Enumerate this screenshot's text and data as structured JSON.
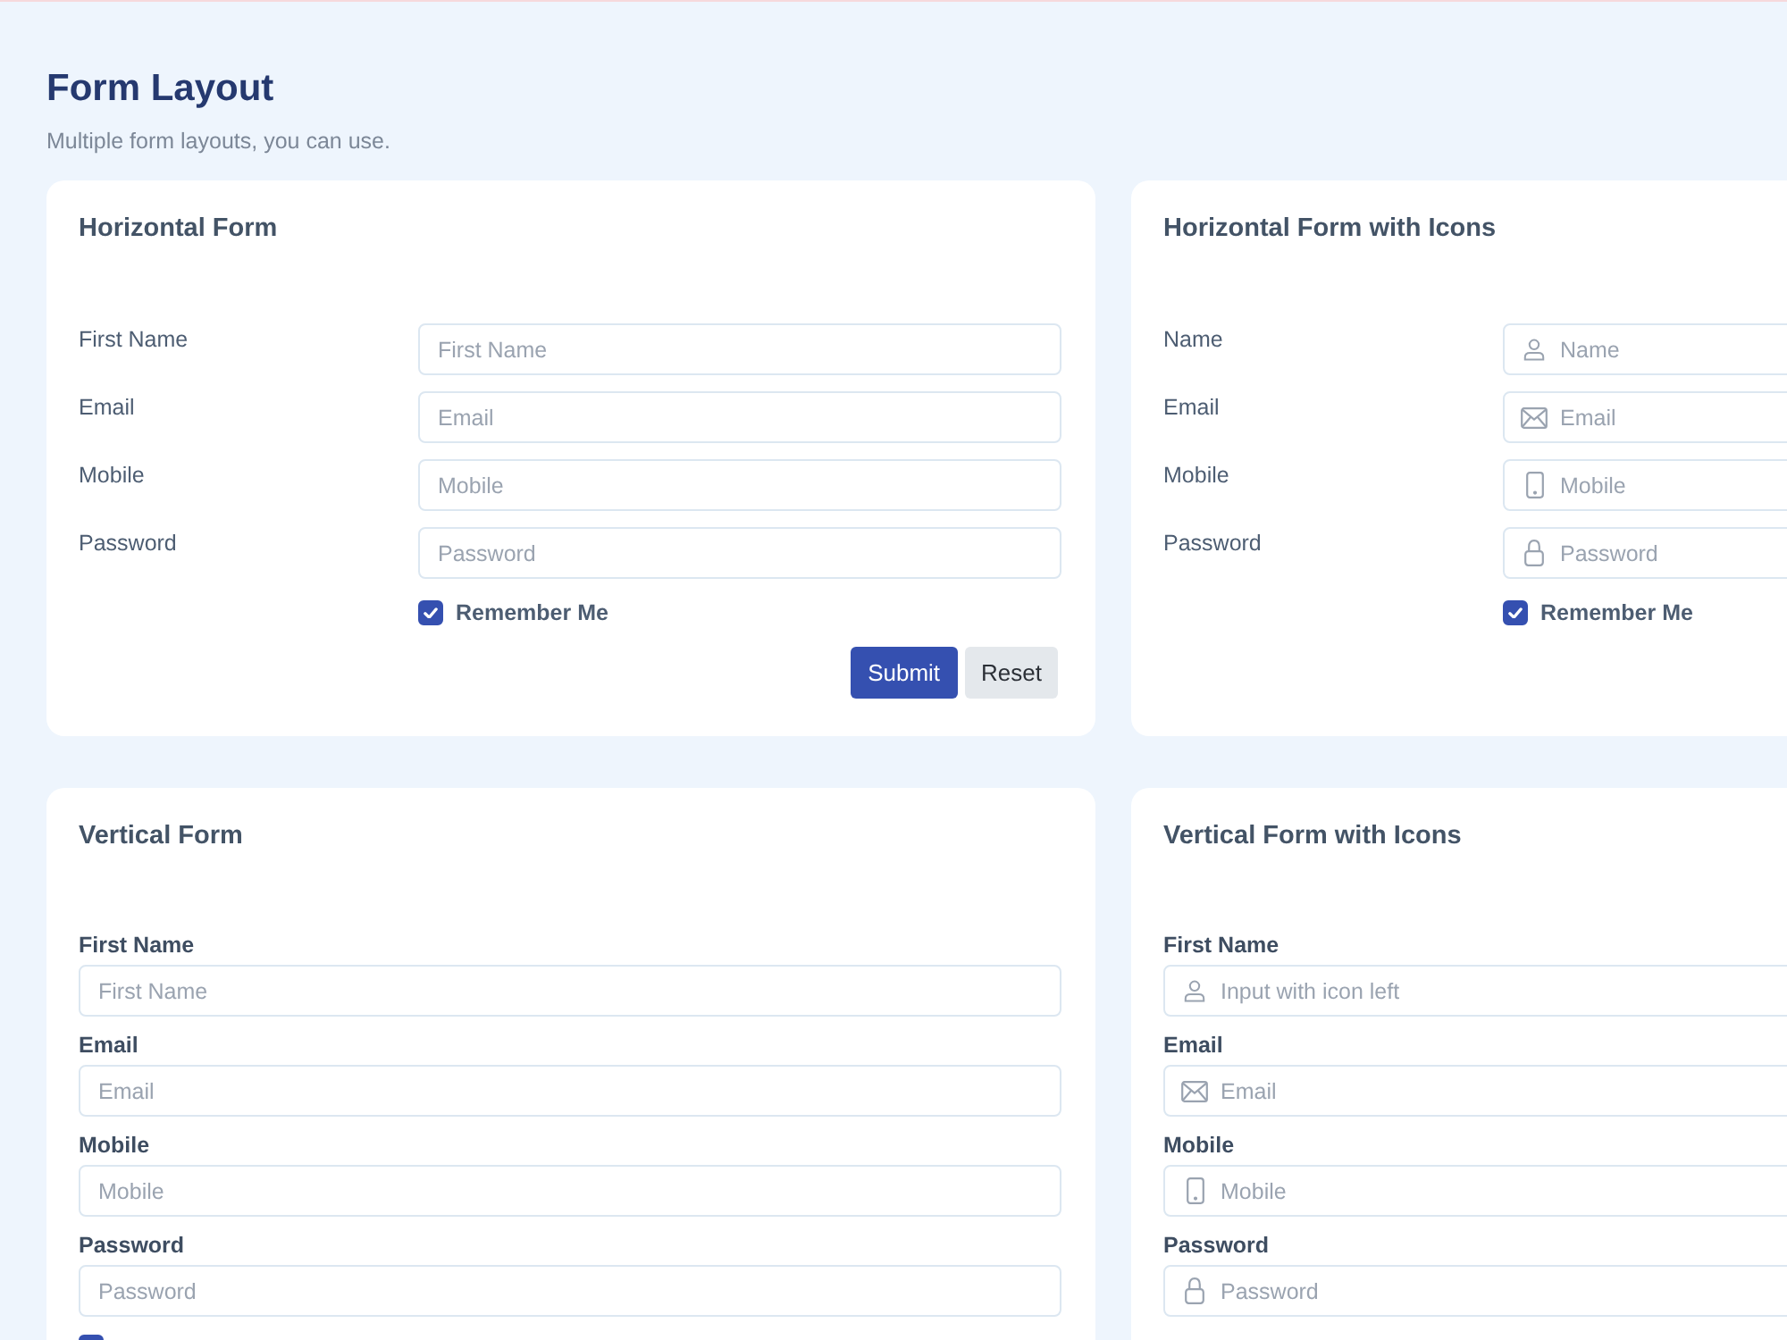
{
  "header": {
    "title": "Form Layout",
    "subtitle": "Multiple form layouts, you can use."
  },
  "cards": [
    {
      "title": "Horizontal Form",
      "kind": "horizontal",
      "fields": [
        {
          "label": "First Name",
          "placeholder": "First Name"
        },
        {
          "label": "Email",
          "placeholder": "Email"
        },
        {
          "label": "Mobile",
          "placeholder": "Mobile"
        },
        {
          "label": "Password",
          "placeholder": "Password"
        }
      ],
      "remember": {
        "label": "Remember Me",
        "checked": true
      },
      "buttons": [
        {
          "label": "Submit",
          "kind": "primary"
        },
        {
          "label": "Reset",
          "kind": "secondary"
        }
      ]
    },
    {
      "title": "Horizontal Form with Icons",
      "kind": "horizontal",
      "fields": [
        {
          "label": "Name",
          "placeholder": "Name",
          "kind": "person"
        },
        {
          "label": "Email",
          "placeholder": "Email",
          "kind": "email"
        },
        {
          "label": "Mobile",
          "placeholder": "Mobile",
          "kind": "mobile"
        },
        {
          "label": "Password",
          "placeholder": "Password",
          "kind": "password"
        }
      ],
      "remember": {
        "label": "Remember Me",
        "checked": true
      }
    },
    {
      "title": "Vertical Form",
      "kind": "vertical",
      "fields": [
        {
          "label": "First Name",
          "placeholder": "First Name"
        },
        {
          "label": "Email",
          "placeholder": "Email"
        },
        {
          "label": "Mobile",
          "placeholder": "Mobile"
        },
        {
          "label": "Password",
          "placeholder": "Password"
        }
      ],
      "remember": {
        "checked": true
      }
    },
    {
      "title": "Vertical Form with Icons",
      "kind": "vertical",
      "fields": [
        {
          "label": "First Name",
          "placeholder": "Input with icon left",
          "kind": "person"
        },
        {
          "label": "Email",
          "placeholder": "Email",
          "kind": "email"
        },
        {
          "label": "Mobile",
          "placeholder": "Mobile",
          "kind": "mobile"
        },
        {
          "label": "Password",
          "placeholder": "Password",
          "kind": "password"
        }
      ]
    }
  ]
}
